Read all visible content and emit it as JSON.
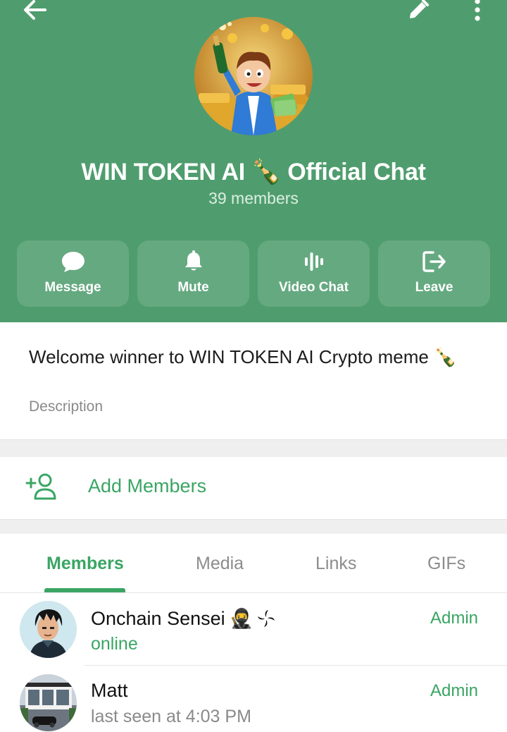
{
  "header": {
    "title": "WIN TOKEN AI 🍾 Official Chat",
    "subtitle": "39 members",
    "background": "#4f9d6e"
  },
  "toolbar": {
    "back_icon": "arrow-left-icon",
    "edit_icon": "pencil-icon",
    "more_icon": "more-vertical-icon"
  },
  "actions": [
    {
      "label": "Message",
      "icon": "chat-bubble-icon"
    },
    {
      "label": "Mute",
      "icon": "bell-icon"
    },
    {
      "label": "Video Chat",
      "icon": "voice-bars-icon"
    },
    {
      "label": "Leave",
      "icon": "logout-icon"
    }
  ],
  "description": {
    "text": "Welcome winner to WIN TOKEN AI  Crypto meme 🍾",
    "label": "Description"
  },
  "add_members": {
    "label": "Add Members",
    "icon": "add-user-icon"
  },
  "tabs": [
    {
      "label": "Members",
      "active": true
    },
    {
      "label": "Media",
      "active": false
    },
    {
      "label": "Links",
      "active": false
    },
    {
      "label": "GIFs",
      "active": false
    }
  ],
  "members": [
    {
      "name": "Onchain Sensei",
      "emoji": "🥷",
      "status": "online",
      "role": "Admin"
    },
    {
      "name": "Matt",
      "emoji": "",
      "status": "last seen at 4:03 PM",
      "role": "Admin"
    }
  ],
  "colors": {
    "accent": "#3aa563",
    "header": "#4f9d6e"
  }
}
